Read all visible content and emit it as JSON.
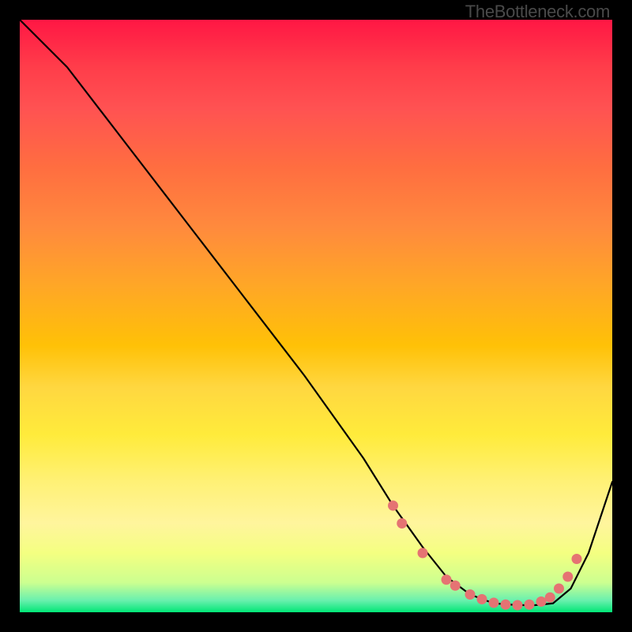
{
  "watermark": "TheBottleneck.com",
  "chart_data": {
    "type": "line",
    "title": "",
    "xlabel": "",
    "ylabel": "",
    "xlim": [
      0,
      100
    ],
    "ylim": [
      0,
      100
    ],
    "series": [
      {
        "name": "bottleneck-curve",
        "x": [
          0,
          8,
          18,
          28,
          38,
          48,
          58,
          63,
          68,
          72,
          76,
          80,
          84,
          87,
          90,
          93,
          96,
          100
        ],
        "values": [
          100,
          92,
          79,
          66,
          53,
          40,
          26,
          18,
          11,
          6,
          3,
          1.5,
          1.2,
          1.2,
          1.5,
          4,
          10,
          22
        ]
      }
    ],
    "markers": {
      "name": "highlighted-range",
      "color": "#e57373",
      "points": [
        {
          "x": 63.0,
          "y": 18.0
        },
        {
          "x": 64.5,
          "y": 15.0
        },
        {
          "x": 68.0,
          "y": 10.0
        },
        {
          "x": 72.0,
          "y": 5.5
        },
        {
          "x": 73.5,
          "y": 4.5
        },
        {
          "x": 76.0,
          "y": 3.0
        },
        {
          "x": 78.0,
          "y": 2.2
        },
        {
          "x": 80.0,
          "y": 1.6
        },
        {
          "x": 82.0,
          "y": 1.3
        },
        {
          "x": 84.0,
          "y": 1.2
        },
        {
          "x": 86.0,
          "y": 1.3
        },
        {
          "x": 88.0,
          "y": 1.8
        },
        {
          "x": 89.5,
          "y": 2.5
        },
        {
          "x": 91.0,
          "y": 4.0
        },
        {
          "x": 92.5,
          "y": 6.0
        },
        {
          "x": 94.0,
          "y": 9.0
        }
      ]
    }
  }
}
